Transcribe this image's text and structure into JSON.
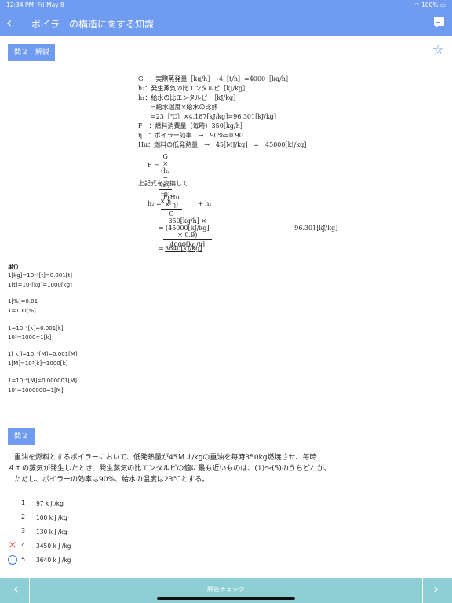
{
  "status_bar": {
    "time": "12:34 PM",
    "date": "Fri May 8",
    "battery": "100%"
  },
  "nav": {
    "back_icon": "chevron-left",
    "title": "ボイラーの構造に関する知識",
    "memo_icon": "chat-bubble"
  },
  "explanation_label": "問２　解説",
  "formula": {
    "lines": [
      "G　：実際蒸発量［kg/h］→4［t/h］=4000［kg/h］",
      "h₂：発生蒸気の比エンタルピ［kJ/kg］",
      "h₁：給水の比エンタルピ　［kJ/kg］",
      "　　=給水温度×給水の比熱",
      "　　=23［℃］×4.187[kJ/kg]=96.301[kJ/kg]",
      "F　：燃料消費量（毎時）350[kg/h]",
      "η　：ボイラー効率　→　90%=0.90",
      "Hu：燃料の低発熱量　→　45[MJ/kg]　=　45000[kJ/kg]"
    ],
    "f_label": "F =",
    "f_num": "G × (h₂ − h₁)",
    "f_den": "Hu × η",
    "transform": "上記式を変換して",
    "h2_label": "h₂ =",
    "h2_num": "F(Hu × η)",
    "h2_den": "G",
    "h2_plus": "+ h₁",
    "eq": "=",
    "calc_num": "350[kg/h] × (45000[kJ/kg] × 0.9)",
    "calc_den": "4000[kg/h]",
    "calc_plus": "+ 96.301[kJ/kg]",
    "result": "3640[kJ/kg]"
  },
  "units": {
    "heading": "単位",
    "lines": [
      "1[kg]=10⁻³[t]=0.001[t]",
      "1[t]=10³[kg]=1000[kg]",
      "1[%]=0.01",
      "1=100[%]",
      "1=10⁻³[k]=0.001[k]",
      "10³=1000=1[k]",
      "1[ k ]=10⁻³[M]=0.001[M]",
      "1[M]=10³[k]=1000[k]",
      "1=10⁻⁶[M]=0.000001[M]",
      "10⁶=1000000=1[M]"
    ]
  },
  "question": {
    "label": "問２",
    "text": [
      "重油を燃料とするボイラーにおいて、低発熱量が45ＭＪ/kgの重油を毎時350kg燃焼させ、毎時",
      "４ｔの蒸気が発生したとき、発生蒸気の比エンタルピの値に最も近いものは、(1)〜(5)のうちどれか。",
      "ただし、ボイラーの効率は90%、給水の温度は23℃とする。"
    ],
    "choices": [
      {
        "num": "1",
        "text": "97 k J /kg",
        "mark": ""
      },
      {
        "num": "2",
        "text": "100 k J /kg",
        "mark": ""
      },
      {
        "num": "3",
        "text": "130 k J /kg",
        "mark": ""
      },
      {
        "num": "4",
        "text": "3450 k J /kg",
        "mark": "×"
      },
      {
        "num": "5",
        "text": "3640 k J /kg",
        "mark": "○"
      }
    ]
  },
  "bottom": {
    "prev_icon": "chevron-left",
    "check_label": "解答チェック",
    "next_icon": "chevron-right"
  },
  "colors": {
    "header": "#6f9bf0",
    "footer": "#8ecfd6",
    "wrong": "#e8574a",
    "correct": "#3b7be8"
  }
}
